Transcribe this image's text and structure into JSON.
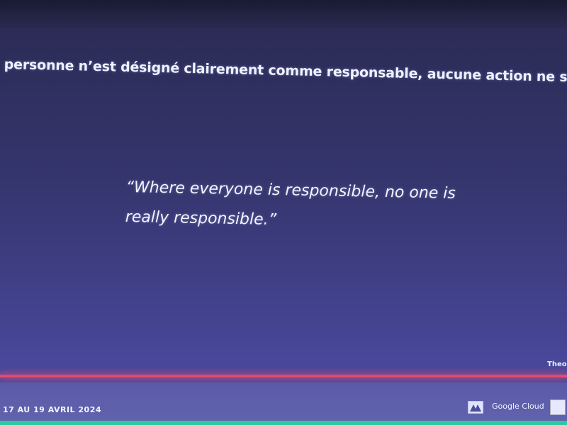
{
  "slide": {
    "headline": "personne n’est désigné clairement comme responsable, aucune action ne sera pris",
    "quote_line1": "“Where everyone is responsible, no one is",
    "quote_line2": "really responsible.”",
    "attribution": "Theo"
  },
  "footer": {
    "date": "17 AU 19 AVRIL 2024",
    "sponsor": "Google Cloud"
  },
  "colors": {
    "background": "#363670",
    "accent_line": "#ff4d6d",
    "text": "#f2f4ff"
  },
  "icons": [
    "sponsor-logo-icon",
    "orange-logo-icon"
  ]
}
